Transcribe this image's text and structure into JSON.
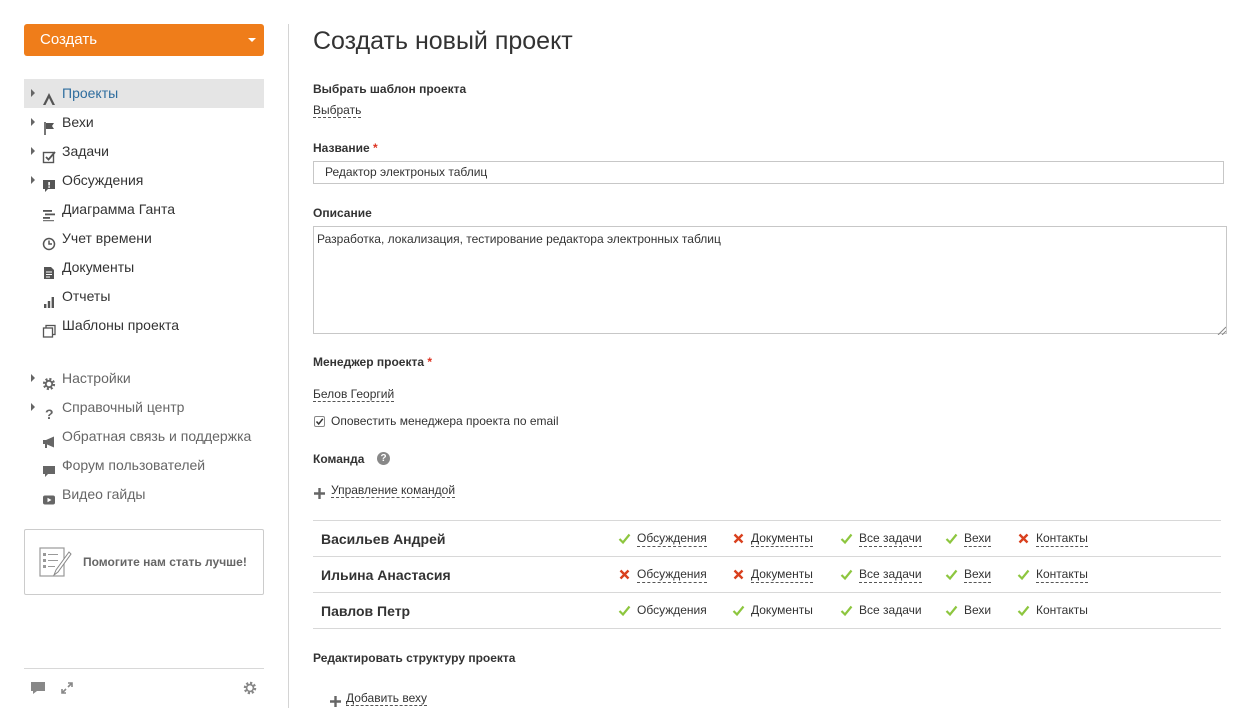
{
  "sidebar": {
    "create_button": "Создать",
    "menu": [
      {
        "label": "Проекты",
        "icon": "projects-icon",
        "expandable": true,
        "active": true
      },
      {
        "label": "Вехи",
        "icon": "flag-icon",
        "expandable": true
      },
      {
        "label": "Задачи",
        "icon": "checkbox-icon",
        "expandable": true
      },
      {
        "label": "Обсуждения",
        "icon": "discussion-icon",
        "expandable": true
      },
      {
        "label": "Диаграмма Ганта",
        "icon": "gantt-icon",
        "expandable": false
      },
      {
        "label": "Учет времени",
        "icon": "clock-icon",
        "expandable": false
      },
      {
        "label": "Документы",
        "icon": "document-icon",
        "expandable": false
      },
      {
        "label": "Отчеты",
        "icon": "reports-icon",
        "expandable": false
      },
      {
        "label": "Шаблоны проекта",
        "icon": "templates-icon",
        "expandable": false
      }
    ],
    "menu2": [
      {
        "label": "Настройки",
        "icon": "gear-icon",
        "expandable": true
      },
      {
        "label": "Справочный центр",
        "icon": "question-icon",
        "expandable": true
      },
      {
        "label": "Обратная связь и поддержка",
        "icon": "megaphone-icon",
        "expandable": false
      },
      {
        "label": "Форум пользователей",
        "icon": "forum-icon",
        "expandable": false
      },
      {
        "label": "Видео гайды",
        "icon": "video-icon",
        "expandable": false
      }
    ],
    "help_box": "Помогите нам стать лучше!"
  },
  "main": {
    "title": "Создать новый проект",
    "template_label": "Выбрать шаблон проекта",
    "template_link": "Выбрать",
    "name_label": "Название",
    "name_value": "Редактор электроных таблиц",
    "description_label": "Описание",
    "description_value": "Разработка, локализация, тестирование редактора электронных таблиц",
    "manager_label": "Менеджер проекта",
    "manager_name": "Белов Георгий",
    "notify_label": "Оповестить менеджера проекта по email",
    "notify_checked": true,
    "team_label": "Команда",
    "team_manage": "Управление командой",
    "team": [
      {
        "name": "Васильев Андрей",
        "perms": [
          {
            "label": "Обсуждения",
            "granted": true
          },
          {
            "label": "Документы",
            "granted": false
          },
          {
            "label": "Все задачи",
            "granted": true
          },
          {
            "label": "Вехи",
            "granted": true
          },
          {
            "label": "Контакты",
            "granted": false
          }
        ]
      },
      {
        "name": "Ильина Анастасия",
        "perms": [
          {
            "label": "Обсуждения",
            "granted": false
          },
          {
            "label": "Документы",
            "granted": false
          },
          {
            "label": "Все задачи",
            "granted": true
          },
          {
            "label": "Вехи",
            "granted": true
          },
          {
            "label": "Контакты",
            "granted": true
          }
        ]
      },
      {
        "name": "Павлов Петр",
        "perms": [
          {
            "label": "Обсуждения",
            "granted": true
          },
          {
            "label": "Документы",
            "granted": true
          },
          {
            "label": "Все задачи",
            "granted": true
          },
          {
            "label": "Вехи",
            "granted": true
          },
          {
            "label": "Контакты",
            "granted": true
          }
        ]
      }
    ],
    "structure_label": "Редактировать структуру проекта",
    "add_milestone": "Добавить веху"
  },
  "colors": {
    "accent": "#ef7d1a",
    "active_link": "#2e6d9e",
    "check": "#8dc63f",
    "cross": "#d9401e"
  }
}
